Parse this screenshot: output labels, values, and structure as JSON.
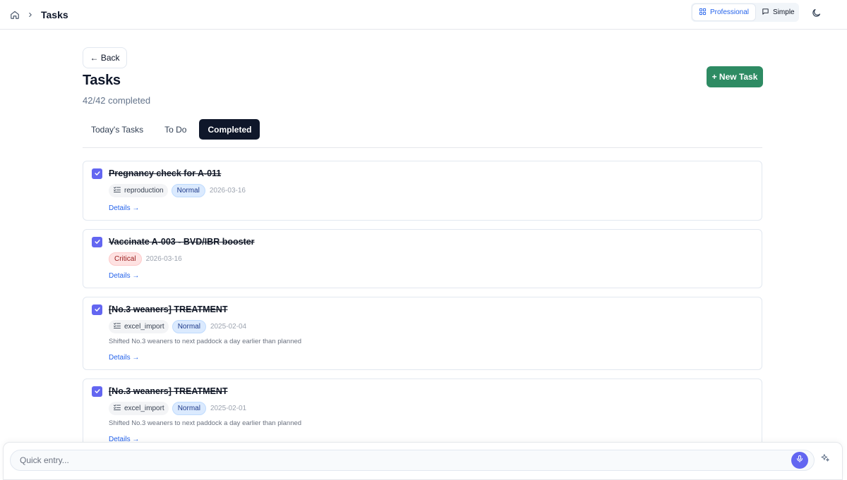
{
  "breadcrumb": {
    "current": "Tasks"
  },
  "view_modes": [
    {
      "label": "Professional",
      "active": true
    },
    {
      "label": "Simple",
      "active": false
    }
  ],
  "back_label": "← Back",
  "page": {
    "title": "Tasks",
    "progress": "42/42 completed"
  },
  "new_task_label": "+ New Task",
  "tabs": [
    {
      "label": "Today's Tasks",
      "active": false
    },
    {
      "label": "To Do",
      "active": false
    },
    {
      "label": "Completed",
      "active": true
    }
  ],
  "tasks": [
    {
      "title": "Pregnancy check for A-011",
      "category": "reproduction",
      "priority": "Normal",
      "date": "2026-03-16",
      "note": "",
      "details": "Details →",
      "done": true
    },
    {
      "title": "Vaccinate A-003 - BVD/IBR booster",
      "category": "",
      "priority": "Critical",
      "date": "2026-03-16",
      "note": "",
      "details": "Details →",
      "done": true
    },
    {
      "title": "[No.3 weaners] TREATMENT",
      "category": "excel_import",
      "priority": "Normal",
      "date": "2025-02-04",
      "note": "Shifted No.3 weaners to next paddock a day earlier than planned",
      "details": "Details →",
      "done": true
    },
    {
      "title": "[No.3 weaners] TREATMENT",
      "category": "excel_import",
      "priority": "Normal",
      "date": "2025-02-01",
      "note": "Shifted No.3 weaners to next paddock a day earlier than planned",
      "details": "Details →",
      "done": true
    }
  ],
  "quick_entry": {
    "placeholder": "Quick entry..."
  },
  "colors": {
    "accent": "#6366f1",
    "primary_action": "#2e8b63",
    "link": "#2563eb",
    "active_tab": "#0f172a"
  },
  "icons": {
    "home": "home-icon",
    "chevron": "chevron-right-icon",
    "grid": "grid-icon",
    "chat": "message-icon",
    "theme": "moon-icon",
    "category": "list-check-icon",
    "check": "check-icon",
    "mic": "mic-icon",
    "ai": "sparkles-icon"
  }
}
